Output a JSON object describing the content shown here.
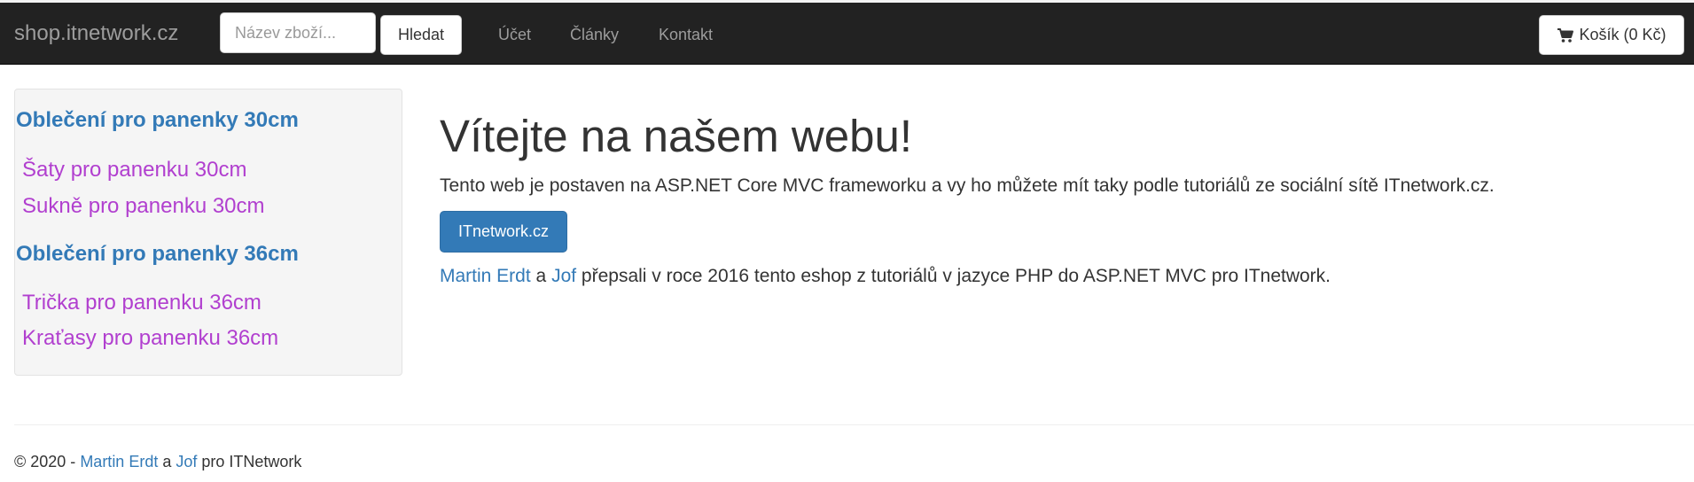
{
  "navbar": {
    "brand": "shop.itnetwork.cz",
    "search": {
      "placeholder": "Název zboží...",
      "value": "",
      "button_label": "Hledat"
    },
    "links": [
      "Účet",
      "Články",
      "Kontakt"
    ],
    "cart": {
      "icon": "shopping-cart-icon",
      "label": "Košík (0 Kč)"
    }
  },
  "sidebar": {
    "categories": [
      {
        "heading": "Oblečení pro panenky 30cm",
        "items": [
          "Šaty pro panenku 30cm",
          "Sukně pro panenku 30cm"
        ]
      },
      {
        "heading": "Oblečení pro panenky 36cm",
        "items": [
          "Trička pro panenku 36cm",
          "Kraťasy pro panenku 36cm"
        ]
      }
    ]
  },
  "main": {
    "title": "Vítejte na našem webu!",
    "intro": "Tento web je postaven na ASP.NET Core MVC frameworku a vy ho můžete mít taky podle tutoriálů ze sociální sítě ITnetwork.cz.",
    "button_label": "ITnetwork.cz",
    "credits": {
      "author1": "Martin Erdt",
      "and": " a ",
      "author2": "Jof",
      "rest": " přepsali v roce 2016 tento eshop z tutoriálů v jazyce PHP do ASP.NET MVC pro ITnetwork."
    }
  },
  "footer": {
    "prefix": "© 2020 - ",
    "author1": "Martin Erdt",
    "and": " a ",
    "author2": "Jof",
    "suffix": " pro ITNetwork"
  },
  "colors": {
    "navbar_bg": "#222222",
    "nav_text": "#9d9d9d",
    "link_blue": "#337ab7",
    "sub_link_purple": "#b13fcf",
    "primary_button": "#337ab7",
    "sidebar_bg": "#f5f5f5"
  }
}
